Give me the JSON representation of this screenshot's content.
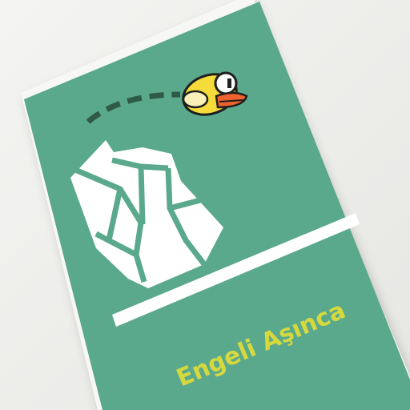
{
  "card": {
    "title": "Engeli Aşınca"
  },
  "icons": [
    "flappy-bird-icon",
    "rock-obstacle-icon"
  ],
  "colors": {
    "background": "#efefed",
    "card": "#5aa98d",
    "title": "#d6d93e",
    "bird_body": "#f5dc3a",
    "bird_beak": "#f0622d",
    "trail": "#2f5a45",
    "rock": "#ffffff"
  }
}
